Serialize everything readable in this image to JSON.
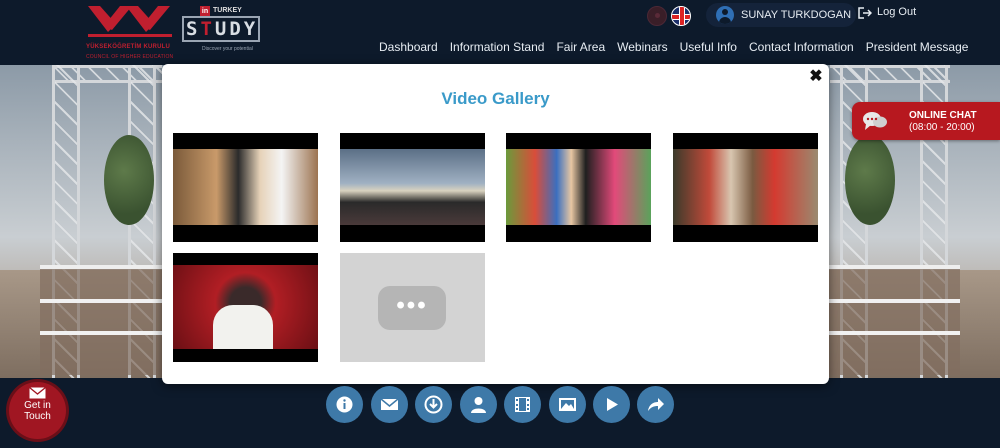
{
  "header": {
    "yok": {
      "name": "YÜKSEKÖĞRETİM KURULU",
      "subtitle": "COUNCIL OF HIGHER EDUCATION"
    },
    "study_logo": {
      "in": "in",
      "turkey": "TURKEY",
      "word_a": "S",
      "word_t": "T",
      "word_b": "UDY",
      "tagline": "Discover your potential"
    },
    "user_name": "SUNAY TURKDOGAN",
    "logout_label": "Log Out",
    "languages": [
      "tr-flag-icon",
      "uk-flag-icon"
    ]
  },
  "nav": {
    "items": [
      {
        "label": "Dashboard"
      },
      {
        "label": "Information Stand"
      },
      {
        "label": "Fair Area"
      },
      {
        "label": "Webinars"
      },
      {
        "label": "Useful Info"
      },
      {
        "label": "Contact Information"
      },
      {
        "label": "President Message"
      }
    ]
  },
  "online_chat": {
    "title": "ONLINE CHAT",
    "hours": "(08:00 - 20:00)",
    "icon": "chat-bubbles-icon"
  },
  "modal": {
    "title": "Video Gallery",
    "close": "✖",
    "videos": [
      {
        "name": "video-thumbnail-1"
      },
      {
        "name": "video-thumbnail-2"
      },
      {
        "name": "video-thumbnail-3"
      },
      {
        "name": "video-thumbnail-4"
      },
      {
        "name": "video-thumbnail-5"
      },
      {
        "name": "video-thumbnail-6",
        "placeholder": true
      }
    ],
    "play_dots": "•••"
  },
  "toolbar": {
    "buttons": [
      "info-icon",
      "mail-icon",
      "download-icon",
      "user-icon",
      "film-icon",
      "image-icon",
      "play-icon",
      "share-icon"
    ]
  },
  "get_in_touch": {
    "label_line1": "Get in",
    "label_line2": "Touch",
    "icon": "envelope-icon"
  },
  "colors": {
    "header_bg": "#0d1a2b",
    "brand_red": "#c01f2f",
    "modal_title": "#3a9ac9",
    "toolbar_button": "#3e79a8",
    "chat_red": "#b7181f"
  }
}
